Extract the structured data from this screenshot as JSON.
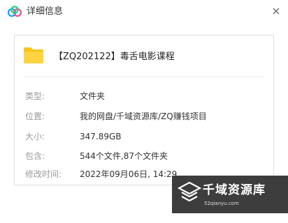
{
  "window": {
    "title": "详细信息",
    "app_icon": "cloud-logo-icon",
    "close_icon": "close-icon"
  },
  "file": {
    "icon": "folder-icon",
    "name": "【ZQ202122】毒舌电影课程"
  },
  "details": {
    "type_label": "类型:",
    "type_value": "文件夹",
    "location_label": "位置:",
    "location_value": "我的网盘/千域资源库/ZQ赚钱项目",
    "size_label": "大小:",
    "size_value": "347.89GB",
    "contains_label": "包含:",
    "contains_value": "544个文件,87个文件夹",
    "modified_label": "修改时间:",
    "modified_value": "2022年09月06日, 14:29"
  },
  "watermark": {
    "text": "千域资源库",
    "subtext": "52qianyu.com"
  },
  "colors": {
    "folder": "#f5c518",
    "accent_blue": "#06a7ff",
    "label_gray": "#9a9a9a",
    "watermark_bg": "#3d3d3d"
  }
}
